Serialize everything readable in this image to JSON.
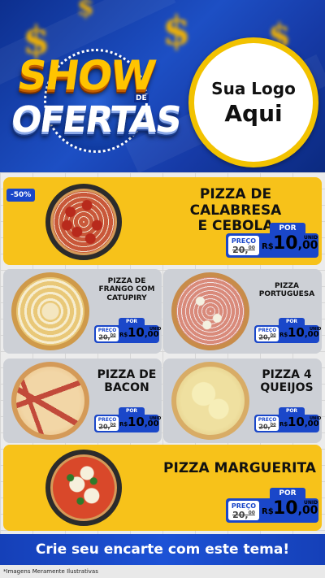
{
  "header": {
    "show_word": "SHOW",
    "de_word": "DE",
    "ofertas_word": "OFERTAS",
    "logo_line1": "Sua Logo",
    "logo_line2": "Aqui"
  },
  "discount_badge": "-50%",
  "price_labels": {
    "por": "POR",
    "preco": "PREÇO",
    "currency": "R$",
    "unid": "UNID"
  },
  "products": [
    {
      "name": "PIZZA DE CALABRESA\nE CEBOLA",
      "old_price": "20,",
      "old_price_sup": "00",
      "price": "10",
      "cents": ",00"
    },
    {
      "name": "PIZZA DE\nFRANGO COM\nCATUPIRY",
      "old_price": "20,",
      "old_price_sup": "00",
      "price": "10",
      "cents": ",00"
    },
    {
      "name": "PIZZA\nPORTUGUESA",
      "old_price": "20,",
      "old_price_sup": "00",
      "price": "10",
      "cents": ",00"
    },
    {
      "name": "PIZZA DE\nBACON",
      "old_price": "20,",
      "old_price_sup": "00",
      "price": "10",
      "cents": ",00"
    },
    {
      "name": "PIZZA 4\nQUEIJOS",
      "old_price": "20,",
      "old_price_sup": "00",
      "price": "10",
      "cents": ",00"
    },
    {
      "name": "PIZZA MARGUERITA",
      "old_price": "20,",
      "old_price_sup": "00",
      "price": "10",
      "cents": ",00"
    }
  ],
  "footer": {
    "cta": "Crie seu encarte com este tema!",
    "disclaimer": "*Imagens Meramente Ilustrativas"
  },
  "colors": {
    "brand_blue": "#1a47c9",
    "header_blue": "#163aa6",
    "yellow": "#f7c21a",
    "card_gray": "#cdd0d6"
  }
}
